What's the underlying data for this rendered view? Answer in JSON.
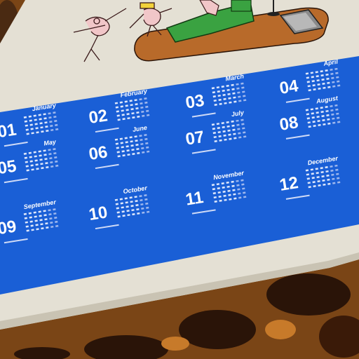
{
  "calendar": {
    "months": [
      {
        "num": "01",
        "name": "January"
      },
      {
        "num": "02",
        "name": "February"
      },
      {
        "num": "03",
        "name": "March"
      },
      {
        "num": "04",
        "name": "April"
      },
      {
        "num": "05",
        "name": "May"
      },
      {
        "num": "06",
        "name": "June"
      },
      {
        "num": "07",
        "name": "July"
      },
      {
        "num": "08",
        "name": "August"
      },
      {
        "num": "09",
        "name": "September"
      },
      {
        "num": "10",
        "name": "October"
      },
      {
        "num": "11",
        "name": "November"
      },
      {
        "num": "12",
        "name": "December"
      }
    ]
  },
  "colors": {
    "band_blue": "#1a5fd6",
    "paper": "#e4e0d4",
    "sofa_green": "#3aa241",
    "rug_brown": "#b86a2a",
    "leopard_dark": "#2a1408",
    "leopard_mid": "#8a4f1c"
  },
  "illustration": {
    "elements": [
      "dancing-figure",
      "dancing-figure",
      "figure-on-sofa",
      "green-sofa",
      "orange-rug",
      "floor-lamp",
      "television"
    ]
  }
}
